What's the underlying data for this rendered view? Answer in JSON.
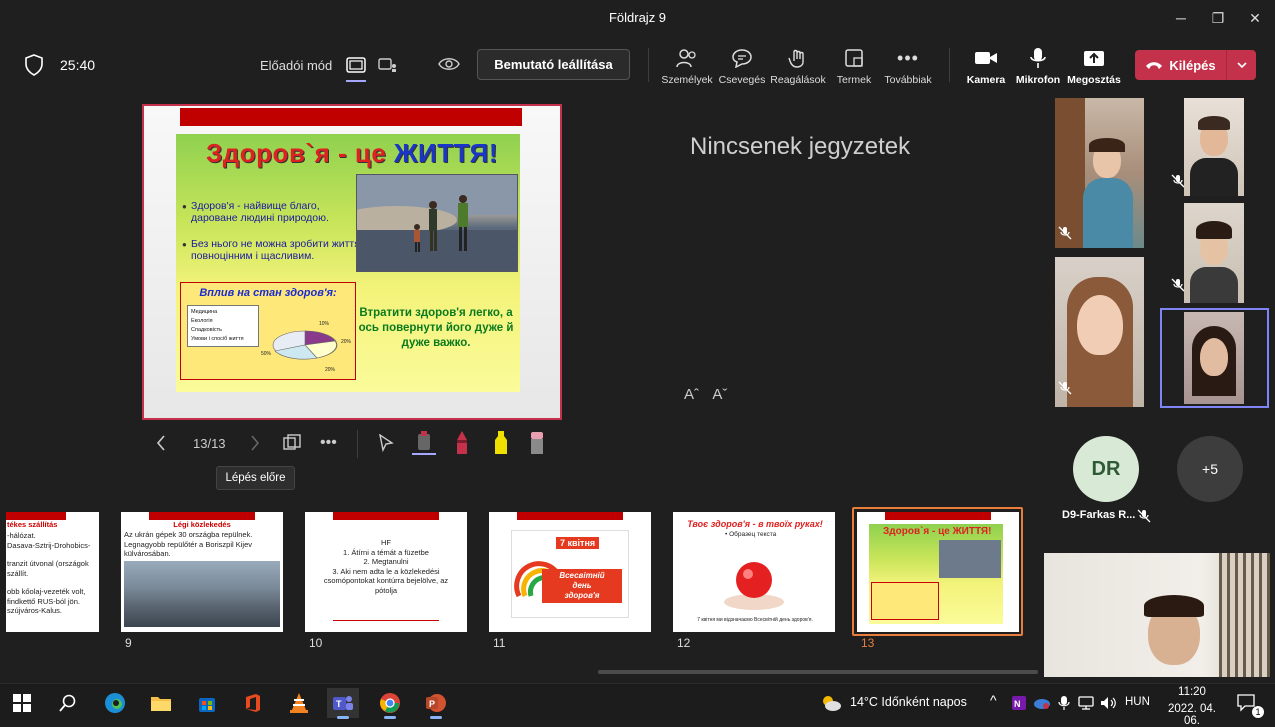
{
  "window": {
    "title": "Földrajz 9",
    "minimize": "─",
    "restore": "❐",
    "close": "✕"
  },
  "meeting": {
    "timer": "25:40",
    "presenter_mode_label": "Előadói mód",
    "stop_presenting_label": "Bemutató leállítása",
    "toolbar": {
      "people": "Személyek",
      "chat": "Csevegés",
      "reactions": "Reagálások",
      "rooms": "Termek",
      "more": "Továbbiak",
      "camera": "Kamera",
      "mic": "Mikrofon",
      "share": "Megosztás"
    },
    "leave_label": "Kilépés"
  },
  "presentation": {
    "current_slide": {
      "title_part1": "Здоров`я - це ",
      "title_part2": "ЖИТТЯ!",
      "bullet1": "Здоров'я - найвище благо, дароване людині природою.",
      "bullet2": "Без нього не можна зробити життя повноцінним і щасливим.",
      "chart_title": "Вплив на стан здоров'я:",
      "legend": [
        "Медицина",
        "Екологія",
        "Спадковість",
        "Умови і спосіб життя"
      ],
      "pie_labels": [
        "10%",
        "20%",
        "20%",
        "50%"
      ],
      "right_text": "Втратити здоров'я легко, а ось повернути його дуже й дуже важко."
    },
    "counter": "13/13",
    "tooltip": "Lépés előre",
    "notes_placeholder": "Nincsenek jegyzetek",
    "font_increase": "Aˆ",
    "font_decrease": "Aˇ"
  },
  "thumbnails": [
    {
      "number": "",
      "title": "tékes szállítás",
      "lines": [
        "-hálózat.",
        "Dasava-Sztrij-Drohobics-",
        "",
        "tranzit útvonal (országok",
        "szállít.",
        "",
        "obb kőolaj-vezeték volt,",
        "findkettő RUS-ból jön.",
        "szújváros-Kalus."
      ]
    },
    {
      "number": "9",
      "title": "Légi közlekedés",
      "lines": [
        "Az ukrán gépek 30 országba repülnek.",
        "Legnagyobb repülőtér a Boriszpil Kijev",
        "külvárosában."
      ]
    },
    {
      "number": "10",
      "title": "HF",
      "lines": [
        "1. Átírni a témát a füzetbe",
        "2. Megtanulni",
        "3. Aki nem adta le a közlekedési",
        "csomópontokat kontúrra bejelölve, az",
        "pótolja"
      ]
    },
    {
      "number": "11",
      "title": "7 квітня",
      "lines": [
        "Всесвітній",
        "день",
        "здоров'я"
      ]
    },
    {
      "number": "12",
      "title": "Твоє здоров'я - в твоїх руках!",
      "lines": [
        "• Образец текста",
        "7 квітня ми відзначаємо Всесвітній день здоров'я."
      ]
    },
    {
      "number": "13",
      "title": "Здоров`я - це ЖИТТЯ!",
      "lines": []
    }
  ],
  "participants": {
    "dr_initials": "DR",
    "dr_name": "D9-Farkas R...",
    "more_count": "+5"
  },
  "taskbar": {
    "weather": "14°C Időnként napos",
    "lang": "HUN",
    "time": "11:20",
    "date": "2022. 04. 06.",
    "notif_count": "1"
  }
}
